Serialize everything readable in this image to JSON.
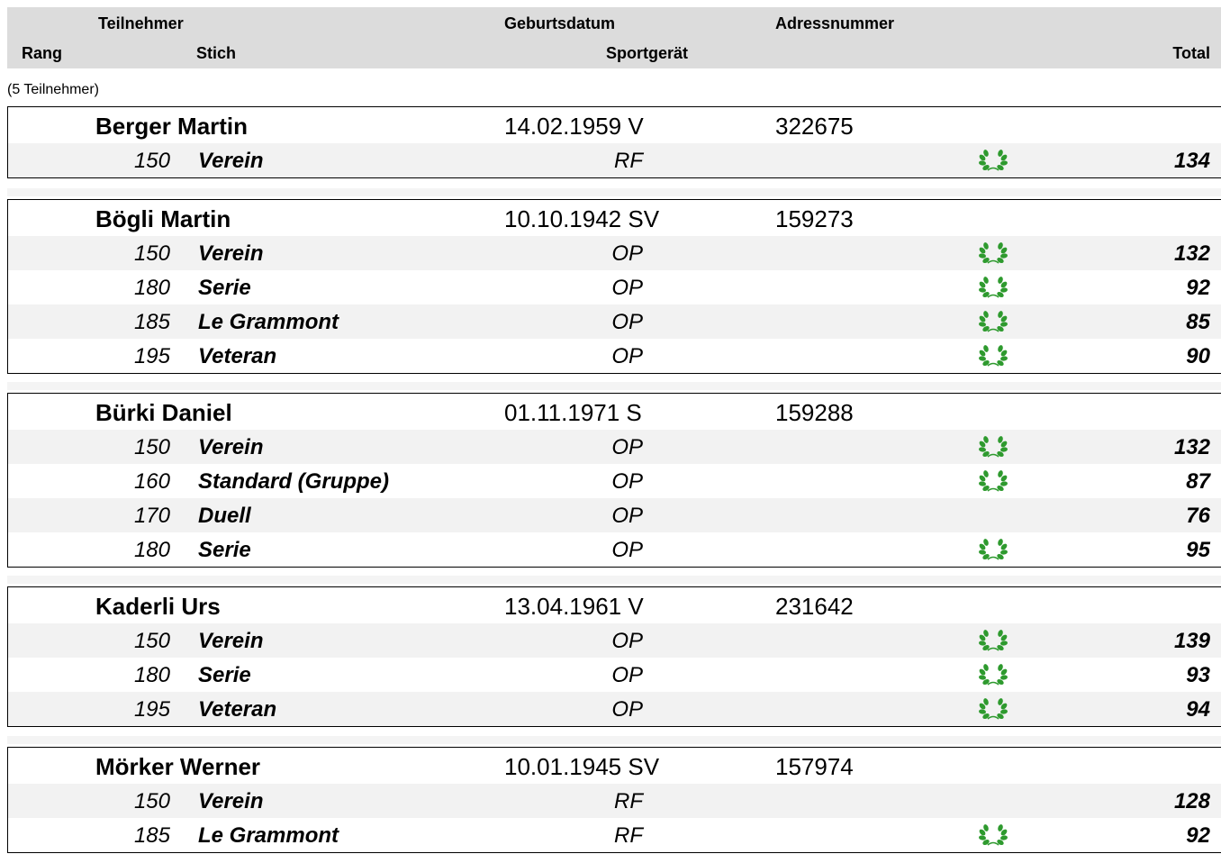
{
  "header": {
    "teilnehmer": "Teilnehmer",
    "geburtsdatum": "Geburtsdatum",
    "adressnummer": "Adressnummer",
    "rang": "Rang",
    "stich": "Stich",
    "sportgeraet": "Sportgerät",
    "total": "Total"
  },
  "count_label": "(5 Teilnehmer)",
  "award_icon": "laurel-wreath-icon",
  "award_color": "#2e9a2e",
  "participants": [
    {
      "name": "Berger Martin",
      "birth": "14.02.1959 V",
      "address": "322675",
      "rows": [
        {
          "stich": "150",
          "name": "Verein",
          "sport": "RF",
          "award": true,
          "total": "134"
        }
      ]
    },
    {
      "name": "Bögli Martin",
      "birth": "10.10.1942 SV",
      "address": "159273",
      "rows": [
        {
          "stich": "150",
          "name": "Verein",
          "sport": "OP",
          "award": true,
          "total": "132"
        },
        {
          "stich": "180",
          "name": "Serie",
          "sport": "OP",
          "award": true,
          "total": "92"
        },
        {
          "stich": "185",
          "name": "Le Grammont",
          "sport": "OP",
          "award": true,
          "total": "85"
        },
        {
          "stich": "195",
          "name": "Veteran",
          "sport": "OP",
          "award": true,
          "total": "90"
        }
      ]
    },
    {
      "name": "Bürki Daniel",
      "birth": "01.11.1971 S",
      "address": "159288",
      "rows": [
        {
          "stich": "150",
          "name": "Verein",
          "sport": "OP",
          "award": true,
          "total": "132"
        },
        {
          "stich": "160",
          "name": "Standard (Gruppe)",
          "sport": "OP",
          "award": true,
          "total": "87"
        },
        {
          "stich": "170",
          "name": "Duell",
          "sport": "OP",
          "award": false,
          "total": "76"
        },
        {
          "stich": "180",
          "name": "Serie",
          "sport": "OP",
          "award": true,
          "total": "95"
        }
      ]
    },
    {
      "name": "Kaderli Urs",
      "birth": "13.04.1961 V",
      "address": "231642",
      "rows": [
        {
          "stich": "150",
          "name": "Verein",
          "sport": "OP",
          "award": true,
          "total": "139"
        },
        {
          "stich": "180",
          "name": "Serie",
          "sport": "OP",
          "award": true,
          "total": "93"
        },
        {
          "stich": "195",
          "name": "Veteran",
          "sport": "OP",
          "award": true,
          "total": "94"
        }
      ]
    },
    {
      "name": "Mörker Werner",
      "birth": "10.01.1945 SV",
      "address": "157974",
      "rows": [
        {
          "stich": "150",
          "name": "Verein",
          "sport": "RF",
          "award": false,
          "total": "128"
        },
        {
          "stich": "185",
          "name": "Le Grammont",
          "sport": "RF",
          "award": true,
          "total": "92"
        }
      ]
    }
  ]
}
